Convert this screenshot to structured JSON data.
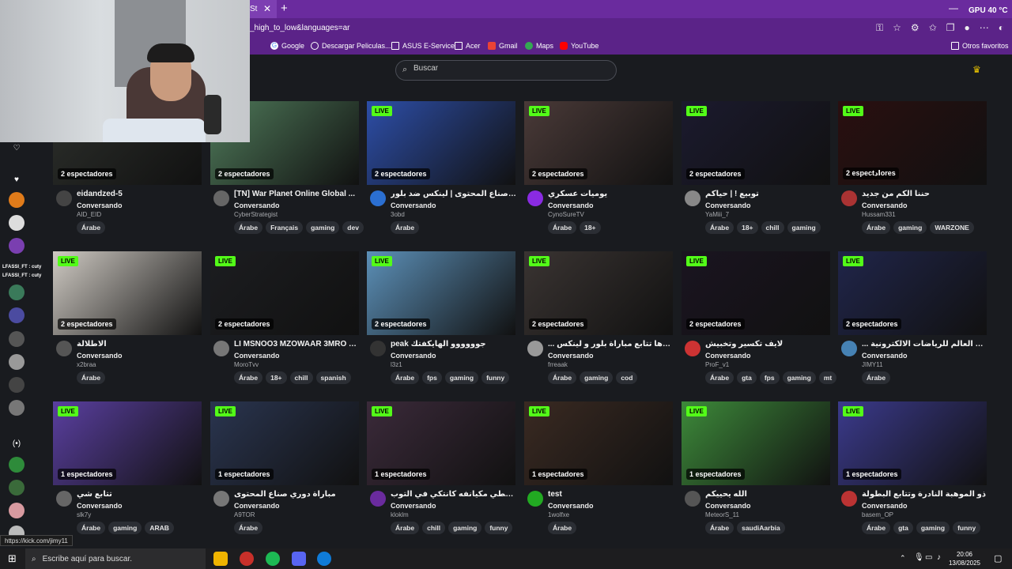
{
  "browser": {
    "tab_label": "St",
    "url": "_high_to_low&languages=ar",
    "gpu_label": "GPU",
    "gpu_temp": "40 °C",
    "bookmarks": [
      {
        "label": "Google",
        "icon": "google-icon",
        "color": "#4285f4"
      },
      {
        "label": "Descargar Peliculas...",
        "icon": "globe-icon",
        "color": "#ffffff"
      },
      {
        "label": "ASUS E-Service",
        "icon": "folder-icon",
        "color": "#ffffff"
      },
      {
        "label": "Acer",
        "icon": "folder-icon",
        "color": "#ffffff"
      },
      {
        "label": "Gmail",
        "icon": "gmail-icon",
        "color": "#ea4335"
      },
      {
        "label": "Maps",
        "icon": "maps-icon",
        "color": "#34a853"
      },
      {
        "label": "YouTube",
        "icon": "youtube-icon",
        "color": "#ff0000"
      }
    ],
    "other_bookmarks": "Otros favoritos"
  },
  "page": {
    "search_placeholder": "Buscar",
    "accent": "#53fc18",
    "sidebar_chat": [
      "LFASSI_FT : cuty",
      "LFASSI_FT : cuty"
    ],
    "streams": [
      {
        "viewers": "2 espectadores",
        "live": "",
        "title": "eidandzed-5",
        "category": "Conversando",
        "user": "AID_EID",
        "tags": [
          "Árabe"
        ],
        "thumb": "#2c2f2b",
        "avatar": "#444"
      },
      {
        "viewers": "2 espectadores",
        "live": "",
        "title": "[TN] War Planet Online Global ...",
        "category": "Conversando",
        "user": "CyberStrategist",
        "tags": [
          "Árabe",
          "Français",
          "gaming",
          "dev"
        ],
        "thumb": "#4f7a5a",
        "avatar": "#666"
      },
      {
        "viewers": "2 espectadores",
        "live": "LIVE",
        "title": "تتابع دوري صناع المحتوى | لينكس ضد بلور",
        "category": "Conversando",
        "user": "3obd",
        "tags": [
          "Árabe"
        ],
        "thumb": "#2d4ea8",
        "avatar": "#2b6fd1"
      },
      {
        "viewers": "2 espectadores",
        "live": "LIVE",
        "title": "يوميات عسكري",
        "category": "Conversando",
        "user": "CynoSureTV",
        "tags": [
          "Árabe",
          "18+"
        ],
        "thumb": "#4a3a38",
        "avatar": "#8a2be2"
      },
      {
        "viewers": "2 espectadores",
        "live": "LIVE",
        "title": "توبيع ! | حياكم",
        "category": "Conversando",
        "user": "YaMiii_7",
        "tags": [
          "Árabe",
          "18+",
          "chill",
          "gaming"
        ],
        "thumb": "#1b1a2e",
        "avatar": "#888"
      },
      {
        "viewers": "2 espectادores",
        "live": "LIVE",
        "title": "حننا الكم من جديد",
        "category": "Conversando",
        "user": "Hussam331",
        "tags": [
          "Árabe",
          "gaming",
          "WARZONE"
        ],
        "thumb": "#2a0f10",
        "avatar": "#a33"
      },
      {
        "viewers": "2 espectadores",
        "live": "LIVE",
        "title": "الاطلالة",
        "category": "Conversando",
        "user": "x2braa",
        "tags": [
          "Árabe"
        ],
        "thumb": "#cfcac3",
        "avatar": "#555"
      },
      {
        "viewers": "2 espectadores",
        "live": "LIVE",
        "title": "LI MSNOO3 MZOWAAR 3MRO YWA...",
        "category": "Conversando",
        "user": "MoroTvv",
        "tags": [
          "Árabe",
          "18+",
          "chill",
          "spanish"
        ],
        "thumb": "#1c1d20",
        "avatar": "#777"
      },
      {
        "viewers": "2 espectadores",
        "live": "LIVE",
        "title": "peak جوووووو الهايكفتك",
        "category": "Conversando",
        "user": "l3z1",
        "tags": [
          "Árabe",
          "fps",
          "gaming",
          "funny"
        ],
        "thumb": "#5c90b8",
        "avatar": "#333"
      },
      {
        "viewers": "2 espectadores",
        "live": "LIVE",
        "title": "... فالكونز ويحدها تتابع مباراة بلور و لينكس",
        "category": "Conversando",
        "user": "frreaak",
        "tags": [
          "Árabe",
          "gaming",
          "cod"
        ],
        "thumb": "#3a3432",
        "avatar": "#999"
      },
      {
        "viewers": "2 espectadores",
        "live": "LIVE",
        "title": "لايف تكسير وتخبيش",
        "category": "Conversando",
        "user": "ProF_v1",
        "tags": [
          "Árabe",
          "gta",
          "fps",
          "gaming",
          "mt"
        ],
        "thumb": "#1a1420",
        "avatar": "#c33"
      },
      {
        "viewers": "2 espectadores",
        "live": "LIVE",
        "title": "... لينكس | كاس العالم للرياضات الالكترونية",
        "category": "Conversando",
        "user": "JIMY11",
        "tags": [
          "Árabe"
        ],
        "thumb": "#20254a",
        "avatar": "#4682b4"
      },
      {
        "viewers": "1 espectadores",
        "live": "LIVE",
        "title": "تتابع شي",
        "category": "Conversando",
        "user": "slk7y",
        "tags": [
          "Árabe",
          "gaming",
          "ARAB"
        ],
        "thumb": "#5a3fa0",
        "avatar": "#666"
      },
      {
        "viewers": "1 espectadores",
        "live": "LIVE",
        "title": "مباراة دوري صناع المحتوى",
        "category": "Conversando",
        "user": "A9TOR",
        "tags": [
          "Árabe"
        ],
        "thumb": "#2a3550",
        "avatar": "#777"
      },
      {
        "viewers": "1 espectadores",
        "live": "LIVE",
        "title": "نلعثم و نحطي مكيانفه كانتكي في التوب",
        "category": "Conversando",
        "user": "kloklm",
        "tags": [
          "Árabe",
          "chill",
          "gaming",
          "funny"
        ],
        "thumb": "#3b2a3a",
        "avatar": "#6a2b9e"
      },
      {
        "viewers": "1 espectadores",
        "live": "LIVE",
        "title": "test",
        "category": "Conversando",
        "user": "1wolfxe",
        "tags": [
          "Árabe"
        ],
        "thumb": "#3a2a22",
        "avatar": "#2a2"
      },
      {
        "viewers": "1 espectadores",
        "live": "LIVE",
        "title": "الله يحييكم",
        "category": "Conversando",
        "user": "MeteorS_11",
        "tags": [
          "Árabe",
          "saudiAarbia"
        ],
        "thumb": "#3d8a3a",
        "avatar": "#555"
      },
      {
        "viewers": "1 espectadores",
        "live": "LIVE",
        "title": "ذو الموهبة النادرة وتتابع البطولة",
        "category": "Conversando",
        "user": "basem_OP",
        "tags": [
          "Árabe",
          "gta",
          "gaming",
          "funny"
        ],
        "thumb": "#3b3a8c",
        "avatar": "#b33"
      }
    ]
  },
  "status_url": "https://kick.com/jimy11",
  "taskbar": {
    "search_placeholder": "Escribe aquí para buscar.",
    "time": "20:06",
    "date": "13/08/2025"
  }
}
